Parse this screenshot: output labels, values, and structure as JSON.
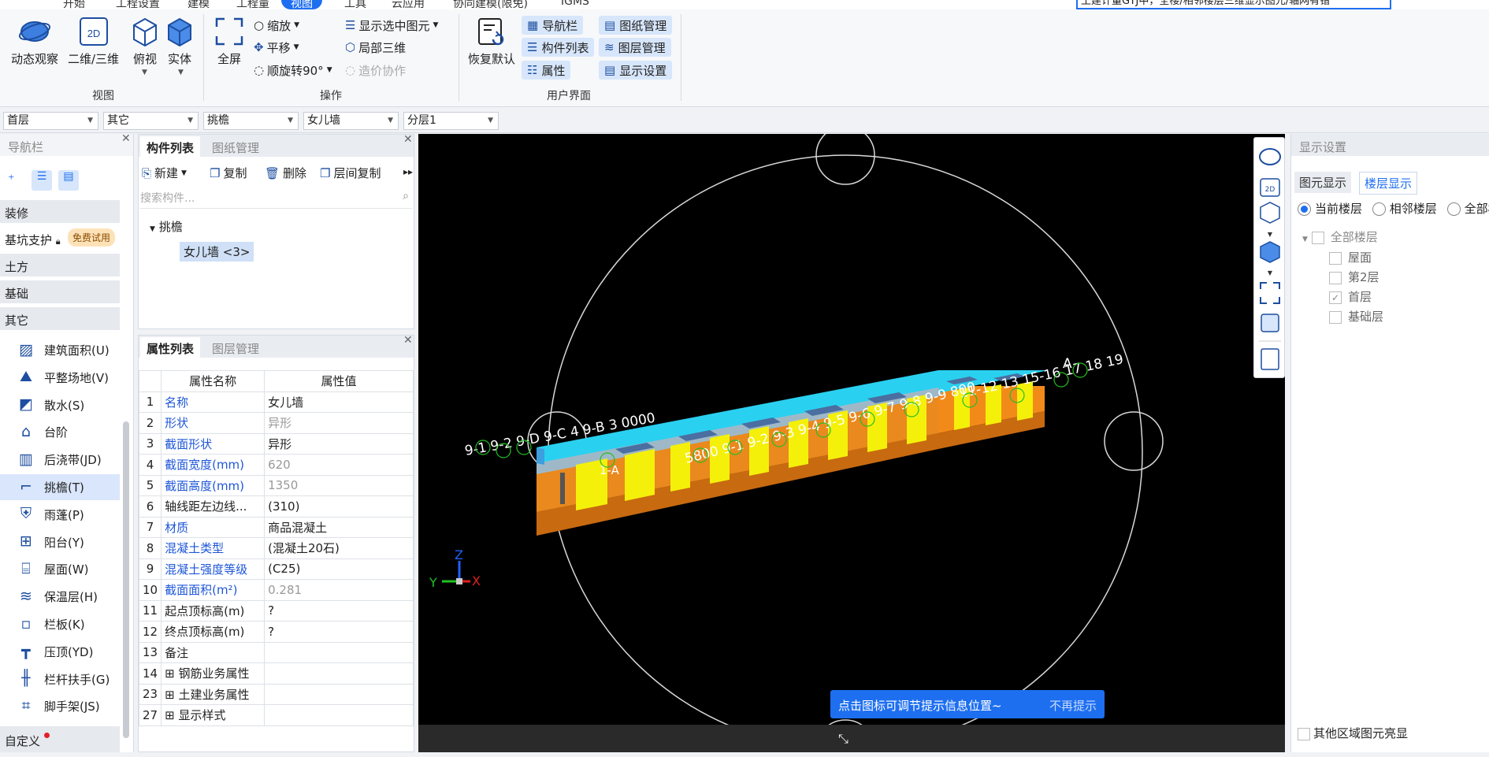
{
  "menubar": {
    "items": [
      "开始",
      "工程设置",
      "建模",
      "工程量",
      "视图",
      "工具",
      "云应用",
      "协同建模(限免)",
      "IGMS"
    ],
    "active_index": 4,
    "search_text": "土建计量GTJ中，全楼/相邻楼层三维显示图元/轴网有错"
  },
  "ribbon": {
    "view_group": {
      "label": "视图",
      "buttons": [
        "动态观察",
        "二维/三维",
        "俯视",
        "实体"
      ],
      "badge_2d": "2D"
    },
    "ops_group": {
      "label": "操作",
      "fullscreen": "全屏",
      "zoom": "缩放",
      "pan": "平移",
      "rotate": "顺旋转90°",
      "show_selected": "显示选中图元",
      "local_3d": "局部三维",
      "cost_collab": "造价协作"
    },
    "ui_group": {
      "label": "用户界面",
      "restore": "恢复默认",
      "navbar": "导航栏",
      "component_list": "构件列表",
      "properties": "属性",
      "drawing_mgmt": "图纸管理",
      "layer_mgmt": "图层管理",
      "display_settings": "显示设置"
    }
  },
  "dropdowns": [
    "首层",
    "其它",
    "挑檐",
    "女儿墙",
    "分层1"
  ],
  "nav": {
    "title": "导航栏",
    "categories": [
      "装修",
      "基坑支护",
      "土方",
      "基础",
      "其它"
    ],
    "trial_badge": "免费试用",
    "items": [
      {
        "label": "建筑面积(U)",
        "icon": "building-area-icon"
      },
      {
        "label": "平整场地(V)",
        "icon": "site-leveling-icon"
      },
      {
        "label": "散水(S)",
        "icon": "apron-icon"
      },
      {
        "label": "台阶",
        "icon": "steps-icon"
      },
      {
        "label": "后浇带(JD)",
        "icon": "post-pour-strip-icon"
      },
      {
        "label": "挑檐(T)",
        "icon": "eave-icon"
      },
      {
        "label": "雨蓬(P)",
        "icon": "canopy-icon"
      },
      {
        "label": "阳台(Y)",
        "icon": "balcony-icon"
      },
      {
        "label": "屋面(W)",
        "icon": "roof-icon"
      },
      {
        "label": "保温层(H)",
        "icon": "insulation-icon"
      },
      {
        "label": "栏板(K)",
        "icon": "breast-board-icon"
      },
      {
        "label": "压顶(YD)",
        "icon": "coping-icon"
      },
      {
        "label": "栏杆扶手(G)",
        "icon": "railing-icon"
      },
      {
        "label": "脚手架(JS)",
        "icon": "scaffold-icon"
      }
    ],
    "selected_index": 5,
    "custom": "自定义"
  },
  "component_panel": {
    "tabs": [
      "构件列表",
      "图纸管理"
    ],
    "new": "新建",
    "copy": "复制",
    "delete": "删除",
    "floor_copy": "层间复制",
    "search_placeholder": "搜索构件...",
    "tree_parent": "挑檐",
    "tree_child": "女儿墙 <3>"
  },
  "property_panel": {
    "tabs": [
      "属性列表",
      "图层管理"
    ],
    "col_name": "属性名称",
    "col_value": "属性值",
    "rows": [
      {
        "no": "1",
        "name": "名称",
        "value": "女儿墙",
        "blue": true,
        "grey": false
      },
      {
        "no": "2",
        "name": "形状",
        "value": "异形",
        "blue": true,
        "grey": true
      },
      {
        "no": "3",
        "name": "截面形状",
        "value": "异形",
        "blue": true,
        "grey": false
      },
      {
        "no": "4",
        "name": "截面宽度(mm)",
        "value": "620",
        "blue": true,
        "grey": true
      },
      {
        "no": "5",
        "name": "截面高度(mm)",
        "value": "1350",
        "blue": true,
        "grey": true
      },
      {
        "no": "6",
        "name": "轴线距左边线...",
        "value": "(310)",
        "blue": false,
        "grey": false
      },
      {
        "no": "7",
        "name": "材质",
        "value": "商品混凝土",
        "blue": true,
        "grey": false
      },
      {
        "no": "8",
        "name": "混凝土类型",
        "value": "(混凝土20石)",
        "blue": true,
        "grey": false
      },
      {
        "no": "9",
        "name": "混凝土强度等级",
        "value": "(C25)",
        "blue": true,
        "grey": false
      },
      {
        "no": "10",
        "name": "截面面积(m²)",
        "value": "0.281",
        "blue": true,
        "grey": true
      },
      {
        "no": "11",
        "name": "起点顶标高(m)",
        "value": "?",
        "blue": false,
        "grey": false
      },
      {
        "no": "12",
        "name": "终点顶标高(m)",
        "value": "?",
        "blue": false,
        "grey": false
      },
      {
        "no": "13",
        "name": "备注",
        "value": "",
        "blue": false,
        "grey": false
      },
      {
        "no": "14",
        "name": "钢筋业务属性",
        "value": "",
        "blue": false,
        "grey": false,
        "expand": true
      },
      {
        "no": "23",
        "name": "土建业务属性",
        "value": "",
        "blue": false,
        "grey": false,
        "expand": true
      },
      {
        "no": "27",
        "name": "显示样式",
        "value": "",
        "blue": false,
        "grey": false,
        "expand": true
      }
    ]
  },
  "viewport": {
    "axis_labels_left": "9-1  9-2  9-D  9-C  4  9-B  3  0000",
    "axis_labels_mid": "5800  9-1  9-2  9-3  9-4  9-5  9-6  9-7  9-8  9-9  800",
    "axis_labels_right": "11-12  13  15-16  17  18  19",
    "label_a": "A",
    "label_1a": "1-A",
    "triad_y": "Y",
    "triad_x": "X",
    "triad_z": "Z",
    "tip_text": "点击图标可调节提示信息位置~",
    "tip_dismiss": "不再提示"
  },
  "display_settings": {
    "title": "显示设置",
    "tabs": [
      "图元显示",
      "楼层显示"
    ],
    "active_tab": 1,
    "radios": [
      "当前楼层",
      "相邻楼层",
      "全部楼层"
    ],
    "tree_root": "全部楼层",
    "floors": [
      {
        "label": "屋面",
        "checked": false
      },
      {
        "label": "第2层",
        "checked": false
      },
      {
        "label": "首层",
        "checked": true
      },
      {
        "label": "基础层",
        "checked": false
      }
    ],
    "other_region": "其他区域图元亮显"
  }
}
